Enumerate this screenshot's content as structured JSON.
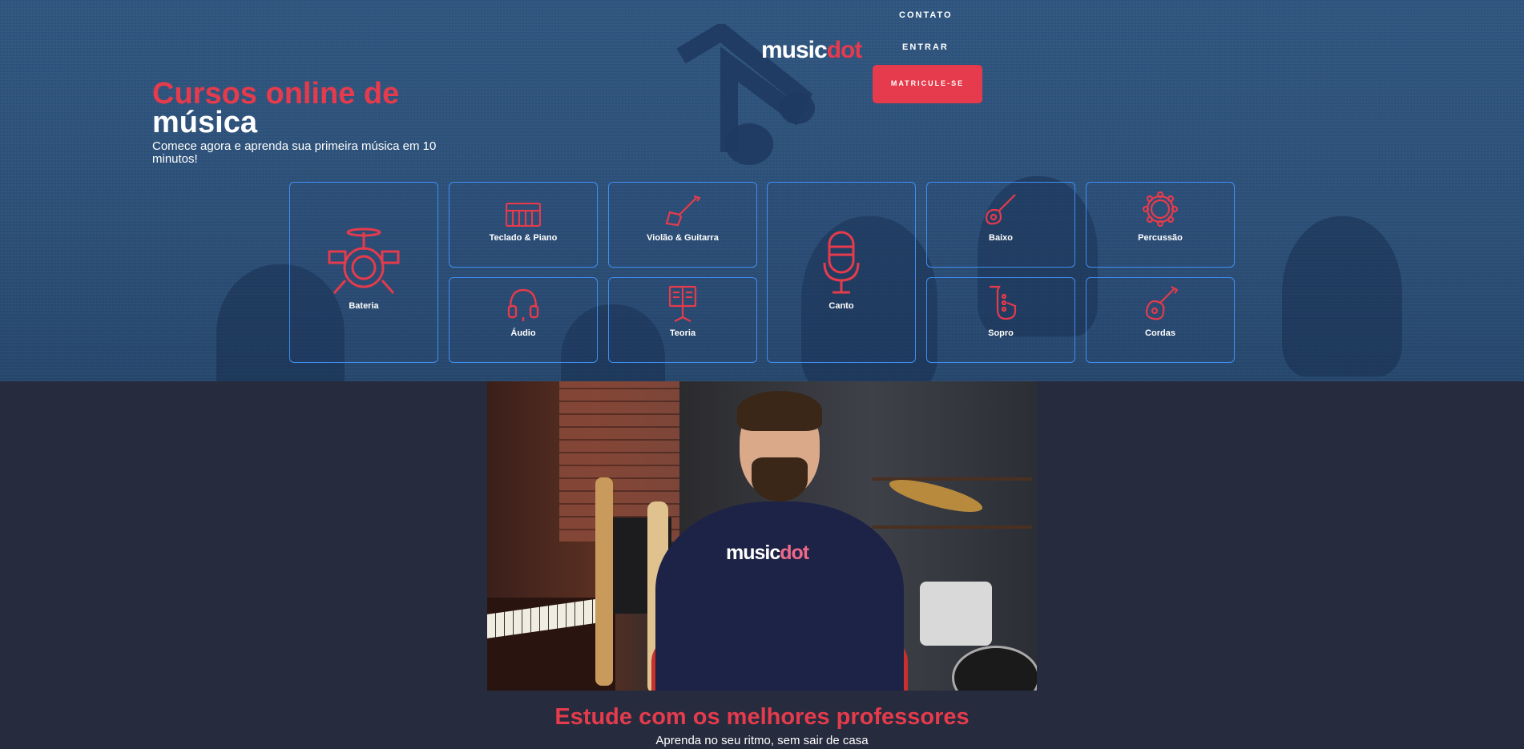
{
  "header": {
    "logo_text": "music",
    "logo_accent": "dot",
    "nav": {
      "contato": "CONTATO",
      "entrar": "ENTRAR"
    },
    "cta": "MATRICULE-SE"
  },
  "hero": {
    "title_line1": "Cursos online de",
    "title_line2": "música",
    "subtitle": "Comece agora e aprenda sua primeira música em 10 minutos!"
  },
  "courses": [
    {
      "label": "Bateria",
      "icon": "drum-kit-icon"
    },
    {
      "label": "Teclado & Piano",
      "icon": "keyboard-icon"
    },
    {
      "label": "Violão & Guitarra",
      "icon": "electric-guitar-icon"
    },
    {
      "label": "Canto",
      "icon": "microphone-icon"
    },
    {
      "label": "Baixo",
      "icon": "bass-guitar-icon"
    },
    {
      "label": "Percussão",
      "icon": "tambourine-icon"
    },
    {
      "label": "Áudio",
      "icon": "headphones-icon"
    },
    {
      "label": "Teoria",
      "icon": "music-stand-icon"
    },
    {
      "label": "Sopro",
      "icon": "saxophone-icon"
    },
    {
      "label": "Cordas",
      "icon": "ukulele-icon"
    }
  ],
  "video": {
    "shirt_logo_text": "music",
    "shirt_logo_accent": "dot"
  },
  "section": {
    "title": "Estude com os melhores professores",
    "subtitle": "Aprenda no seu ritmo, sem sair de casa"
  },
  "colors": {
    "accent": "#e53b4c",
    "card_border": "#3f8ef2",
    "hero_bg": "#2f5680",
    "page_bg": "#262b3d"
  }
}
